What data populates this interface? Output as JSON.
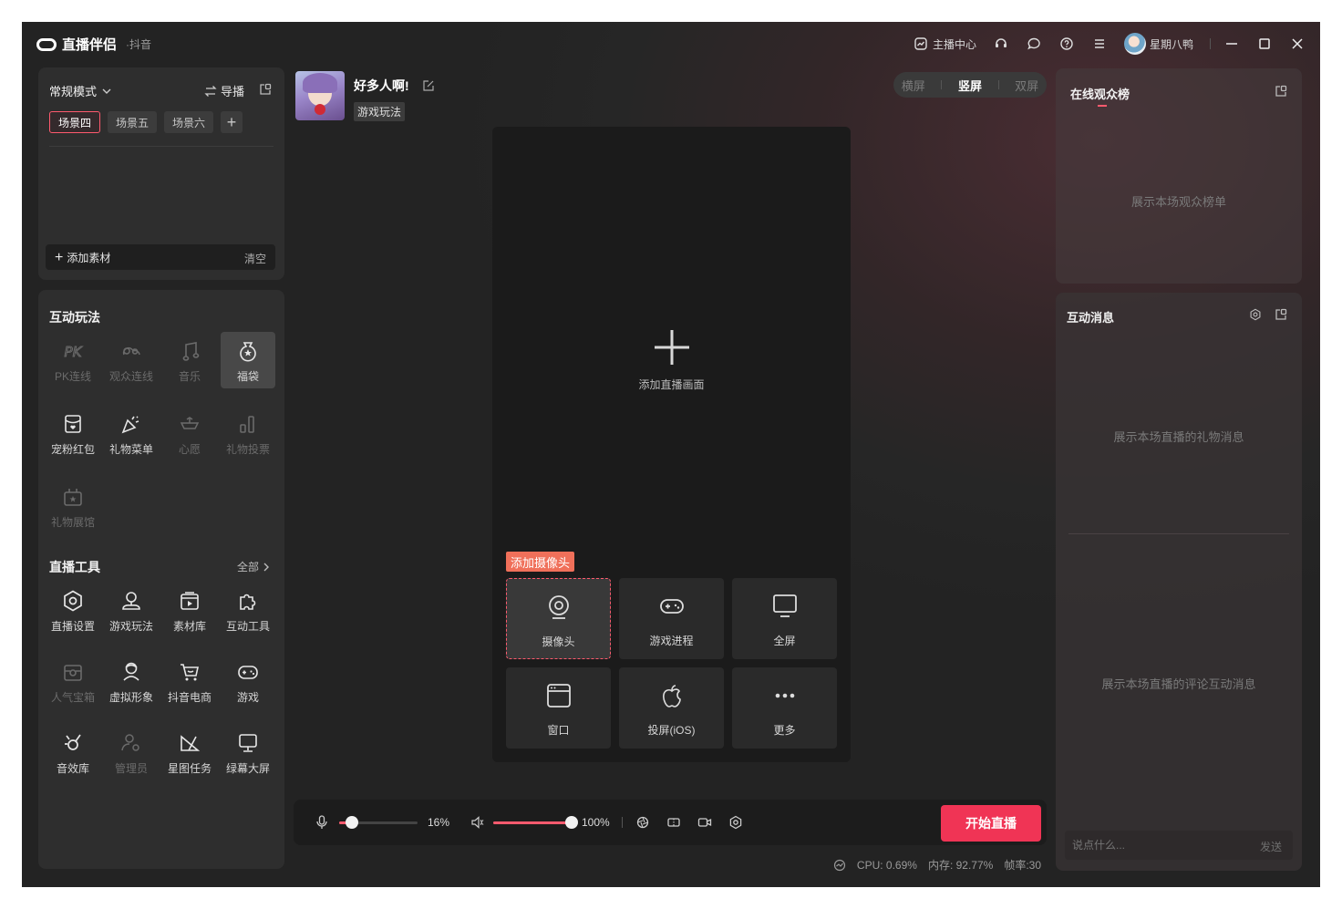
{
  "titlebar": {
    "app_name": "直播伴侣",
    "platform": "·抖音",
    "creator_center": "主播中心",
    "username": "星期八鸭",
    "icons": [
      "headset-icon",
      "chat-icon",
      "help-icon",
      "menu-icon",
      "minimize-icon",
      "maximize-icon",
      "close-icon"
    ]
  },
  "scene_panel": {
    "mode": "常规模式",
    "director": "导播",
    "scenes": [
      "场景四",
      "场景五",
      "场景六"
    ],
    "add_material": "添加素材",
    "clear": "清空"
  },
  "interactive": {
    "title": "互动玩法",
    "items": [
      {
        "label": "PK连线",
        "icon": "pk-icon",
        "enabled": false
      },
      {
        "label": "观众连线",
        "icon": "audience-link-icon",
        "enabled": false
      },
      {
        "label": "音乐",
        "icon": "music-icon",
        "enabled": false
      },
      {
        "label": "福袋",
        "icon": "lucky-bag-icon",
        "enabled": true,
        "selected": true
      },
      {
        "label": "宠粉红包",
        "icon": "red-packet-icon",
        "enabled": true
      },
      {
        "label": "礼物菜单",
        "icon": "gift-menu-icon",
        "enabled": true
      },
      {
        "label": "心愿",
        "icon": "wish-icon",
        "enabled": false
      },
      {
        "label": "礼物投票",
        "icon": "gift-vote-icon",
        "enabled": false
      },
      {
        "label": "礼物展馆",
        "icon": "gift-gallery-icon",
        "enabled": false
      }
    ]
  },
  "tools": {
    "title": "直播工具",
    "all": "全部",
    "items": [
      {
        "label": "直播设置",
        "icon": "settings-icon",
        "enabled": true
      },
      {
        "label": "游戏玩法",
        "icon": "game-play-icon",
        "enabled": true
      },
      {
        "label": "素材库",
        "icon": "media-library-icon",
        "enabled": true
      },
      {
        "label": "互动工具",
        "icon": "puzzle-icon",
        "enabled": true
      },
      {
        "label": "人气宝箱",
        "icon": "treasure-box-icon",
        "enabled": false
      },
      {
        "label": "虚拟形象",
        "icon": "avatar-icon",
        "enabled": true
      },
      {
        "label": "抖音电商",
        "icon": "cart-icon",
        "enabled": true
      },
      {
        "label": "游戏",
        "icon": "gamepad-icon",
        "enabled": true
      },
      {
        "label": "音效库",
        "icon": "sound-effect-icon",
        "enabled": true
      },
      {
        "label": "管理员",
        "icon": "admin-icon",
        "enabled": false
      },
      {
        "label": "星图任务",
        "icon": "star-task-icon",
        "enabled": true
      },
      {
        "label": "绿幕大屏",
        "icon": "green-screen-icon",
        "enabled": true
      }
    ]
  },
  "stream_info": {
    "title": "好多人啊!",
    "category": "游戏玩法"
  },
  "orientation": {
    "options": [
      "横屏",
      "竖屏",
      "双屏"
    ],
    "selected": "竖屏"
  },
  "preview": {
    "add_label": "添加直播画面",
    "camera_badge": "添加摄像头",
    "sources": [
      {
        "label": "摄像头",
        "icon": "camera-icon"
      },
      {
        "label": "游戏进程",
        "icon": "gamepad-icon"
      },
      {
        "label": "全屏",
        "icon": "monitor-icon"
      },
      {
        "label": "窗口",
        "icon": "window-icon"
      },
      {
        "label": "投屏(iOS)",
        "icon": "apple-icon"
      },
      {
        "label": "更多",
        "icon": "more-icon"
      }
    ]
  },
  "controls": {
    "mic_percent": "16%",
    "mic_level": 0.16,
    "speaker_percent": "100%",
    "speaker_level": 1.0,
    "start_label": "开始直播"
  },
  "status": {
    "cpu": "CPU: 0.69%",
    "memory": "内存: 92.77%",
    "fps": "帧率:30"
  },
  "ranking": {
    "title": "在线观众榜",
    "placeholder": "展示本场观众榜单"
  },
  "messages": {
    "title": "互动消息",
    "gift_placeholder": "展示本场直播的礼物消息",
    "comment_placeholder": "展示本场直播的评论互动消息",
    "input_placeholder": "说点什么...",
    "send": "发送"
  },
  "colors": {
    "accent": "#f03455",
    "highlight": "#ff5a6e",
    "badge": "#f0705a"
  }
}
